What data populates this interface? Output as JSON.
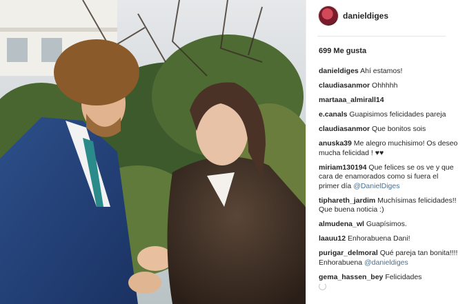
{
  "post": {
    "username": "danieldiges",
    "likes": "699 Me gusta"
  },
  "comments": [
    {
      "user": "danieldiges",
      "text": "Ahí estamos!"
    },
    {
      "user": "claudiasanmor",
      "text": "Ohhhhh"
    },
    {
      "user": "martaaa_almirall14",
      "text": ""
    },
    {
      "user": "e.canals",
      "text": "Guapisimos felicidades pareja"
    },
    {
      "user": "claudiasanmor",
      "text": "Que bonitos sois"
    },
    {
      "user": "anuska39",
      "text": "Me alegro muchisimo! Os deseo mucha felicidad ! ♥♥"
    },
    {
      "user": "miriam130194",
      "text": "Que felices se os ve y que cara de enamorados como si fuera el primer día",
      "mention": "@DanielDiges"
    },
    {
      "user": "tiphareth_jardim",
      "text": "Muchísimas felicidades!! Que buena noticia :)"
    },
    {
      "user": "almudena_wl",
      "text": "Guapísimos."
    },
    {
      "user": "laauu12",
      "text": "Enhorabuena Dani!"
    },
    {
      "user": "purigar_delmoral",
      "text": "Qué pareja tan bonita!!!! Enhorabuena",
      "mention": "@danieldiges"
    },
    {
      "user": "gema_hassen_bey",
      "text": "Felicidades"
    }
  ],
  "colors": {
    "mention": "#3f729b",
    "text": "#262626"
  },
  "icons": {
    "loading": "loading-spinner-icon"
  }
}
